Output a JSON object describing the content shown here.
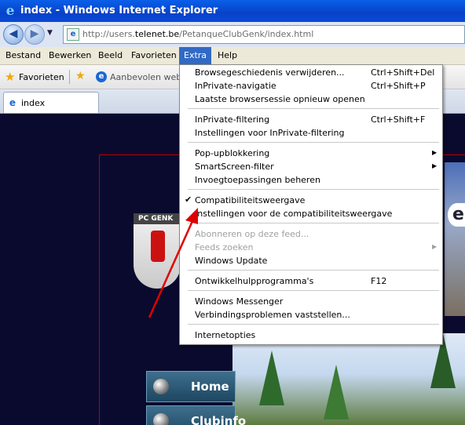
{
  "window": {
    "title": "index - Windows Internet Explorer"
  },
  "address": {
    "url_prefix": "http://users.",
    "url_domain": "telenet.be",
    "url_suffix": "/PetanqueClubGenk/index.html"
  },
  "menubar": [
    "Bestand",
    "Bewerken",
    "Beeld",
    "Favorieten",
    "Extra",
    "Help"
  ],
  "favorites": {
    "label": "Favorieten",
    "suggested": "Aanbevolen websi"
  },
  "tab": {
    "label": "index"
  },
  "dropdown": {
    "items": [
      {
        "label": "Browsegeschiedenis verwijderen...",
        "shortcut": "Ctrl+Shift+Del"
      },
      {
        "label": "InPrivate-navigatie",
        "shortcut": "Ctrl+Shift+P"
      },
      {
        "label": "Laatste browsersessie opnieuw openen",
        "shortcut": ""
      },
      {
        "label": "InPrivate-filtering",
        "shortcut": "Ctrl+Shift+F"
      },
      {
        "label": "Instellingen voor InPrivate-filtering",
        "shortcut": ""
      },
      {
        "label": "Pop-upblokkering",
        "shortcut": ""
      },
      {
        "label": "SmartScreen-filter",
        "shortcut": ""
      },
      {
        "label": "Invoegtoepassingen beheren",
        "shortcut": ""
      },
      {
        "label": "Compatibiliteitsweergave",
        "shortcut": ""
      },
      {
        "label": "Instellingen voor de compatibiliteitsweergave",
        "shortcut": ""
      },
      {
        "label": "Abonneren op deze feed...",
        "shortcut": ""
      },
      {
        "label": "Feeds zoeken",
        "shortcut": ""
      },
      {
        "label": "Windows Update",
        "shortcut": ""
      },
      {
        "label": "Ontwikkelhulpprogramma's",
        "shortcut": "F12"
      },
      {
        "label": "Windows Messenger",
        "shortcut": ""
      },
      {
        "label": "Verbindingsproblemen vaststellen...",
        "shortcut": ""
      },
      {
        "label": "Internetopties",
        "shortcut": ""
      }
    ]
  },
  "site": {
    "logo_text": "PC GENK",
    "bubble_text": "e",
    "nav": [
      "Home",
      "Clubinfo"
    ]
  },
  "colors": {
    "accent": "#316ac5",
    "annotation": "#e00000"
  }
}
